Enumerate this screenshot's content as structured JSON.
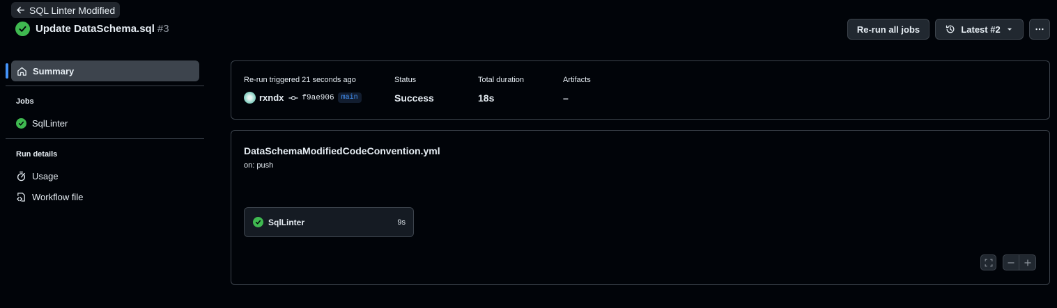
{
  "header": {
    "back_label": "SQL Linter Modified",
    "run_title": "Update DataSchema.sql",
    "run_number": "#3",
    "rerun_button": "Re-run all jobs",
    "attempt_button": "Latest #2"
  },
  "sidebar": {
    "summary_label": "Summary",
    "jobs_heading": "Jobs",
    "jobs": [
      {
        "label": "SqlLinter"
      }
    ],
    "run_details_heading": "Run details",
    "usage_label": "Usage",
    "workflow_file_label": "Workflow file"
  },
  "summary": {
    "trigger_label": "Re-run triggered 21 seconds ago",
    "actor": "rxndx",
    "sha": "f9ae906",
    "branch": "main",
    "status_label": "Status",
    "status_value": "Success",
    "duration_label": "Total duration",
    "duration_value": "18s",
    "artifacts_label": "Artifacts",
    "artifacts_value": "–"
  },
  "workflow": {
    "file_name": "DataSchemaModifiedCodeConvention.yml",
    "trigger": "on: push",
    "job": {
      "name": "SqlLinter",
      "duration": "9s"
    }
  },
  "colors": {
    "success": "#3fb950",
    "accent": "#4493f8",
    "background": "#010409",
    "border": "#3d444d"
  }
}
